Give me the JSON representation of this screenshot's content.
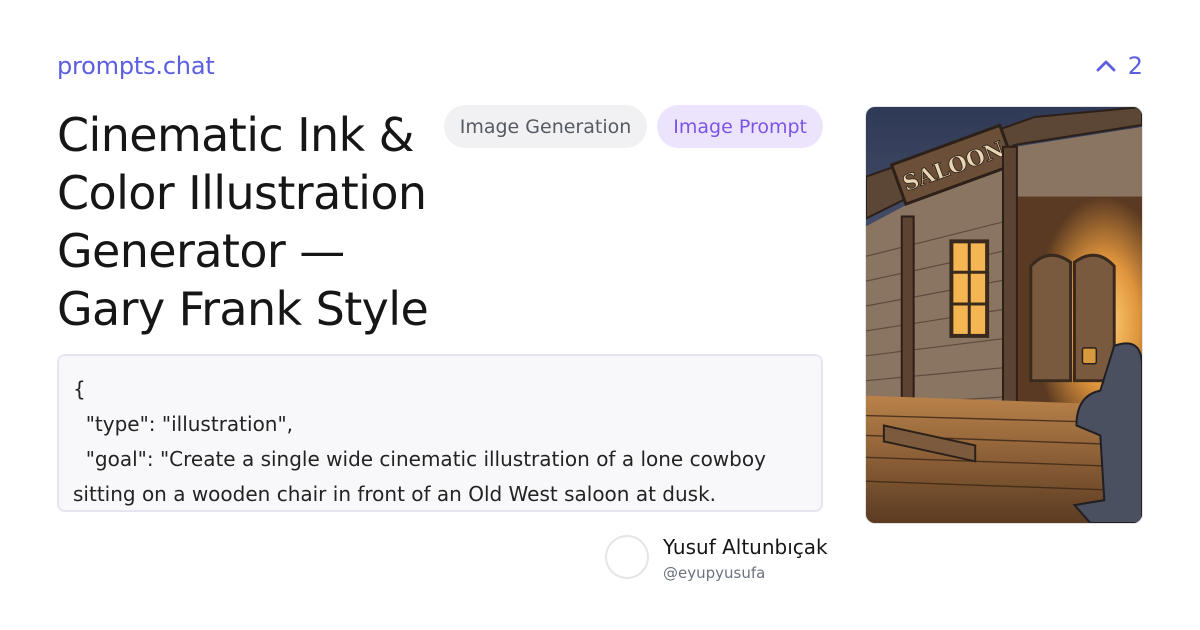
{
  "site": {
    "name": "prompts.chat"
  },
  "upvote": {
    "count": "2",
    "icon": "chevron-up-icon"
  },
  "prompt": {
    "title": "Cinematic Ink & Color Illustration Generator — Gary Frank Style",
    "tags": [
      "Image Generation",
      "Image Prompt"
    ],
    "content": "{\n  \"type\": \"illustration\",\n  \"goal\": \"Create a single wide cinematic illustration of a lone cowboy sitting on a wooden chair in front of an Old West saloon at dusk.",
    "image": {
      "sign_text": "SALOON"
    }
  },
  "author": {
    "name": "Yusuf Altunbıçak",
    "handle": "@eyupyusufa"
  },
  "colors": {
    "accent": "#5b5fe0",
    "tag_purple_bg": "#ece4fd",
    "tag_purple_text": "#7c55e6"
  }
}
